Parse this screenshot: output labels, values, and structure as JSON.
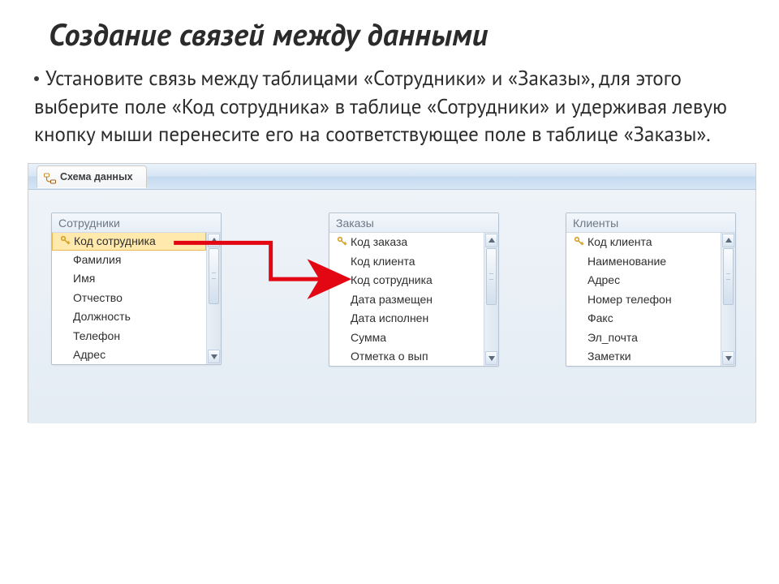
{
  "slide": {
    "title": "Создание связей между данными",
    "body": "Установите связь между таблицами «Сотрудники» и «Заказы», для этого выберите поле «Код сотрудника» в таблице «Сотрудники» и удерживая левую кнопку мыши перенесите его на соответствующее поле в таблице «Заказы»."
  },
  "schema_tab": "Схема данных",
  "tables": {
    "employees": {
      "title": "Сотрудники",
      "fields": [
        "Код сотрудника",
        "Фамилия",
        "Имя",
        "Отчество",
        "Должность",
        "Телефон",
        "Адрес"
      ],
      "pk_index": 0,
      "selected_index": 0
    },
    "orders": {
      "title": "Заказы",
      "fields": [
        "Код заказа",
        "Код клиента",
        "Код сотрудника",
        "Дата размещен",
        "Дата исполнен",
        "Сумма",
        "Отметка о вып"
      ],
      "pk_index": 0
    },
    "clients": {
      "title": "Клиенты",
      "fields": [
        "Код клиента",
        "Наименование",
        "Адрес",
        "Номер телефон",
        "Факс",
        "Эл_почта",
        "Заметки"
      ],
      "pk_index": 0
    }
  },
  "colors": {
    "arrow": "#e30613",
    "highlight_bg": "#ffe9ad",
    "highlight_border": "#e9b84f"
  }
}
